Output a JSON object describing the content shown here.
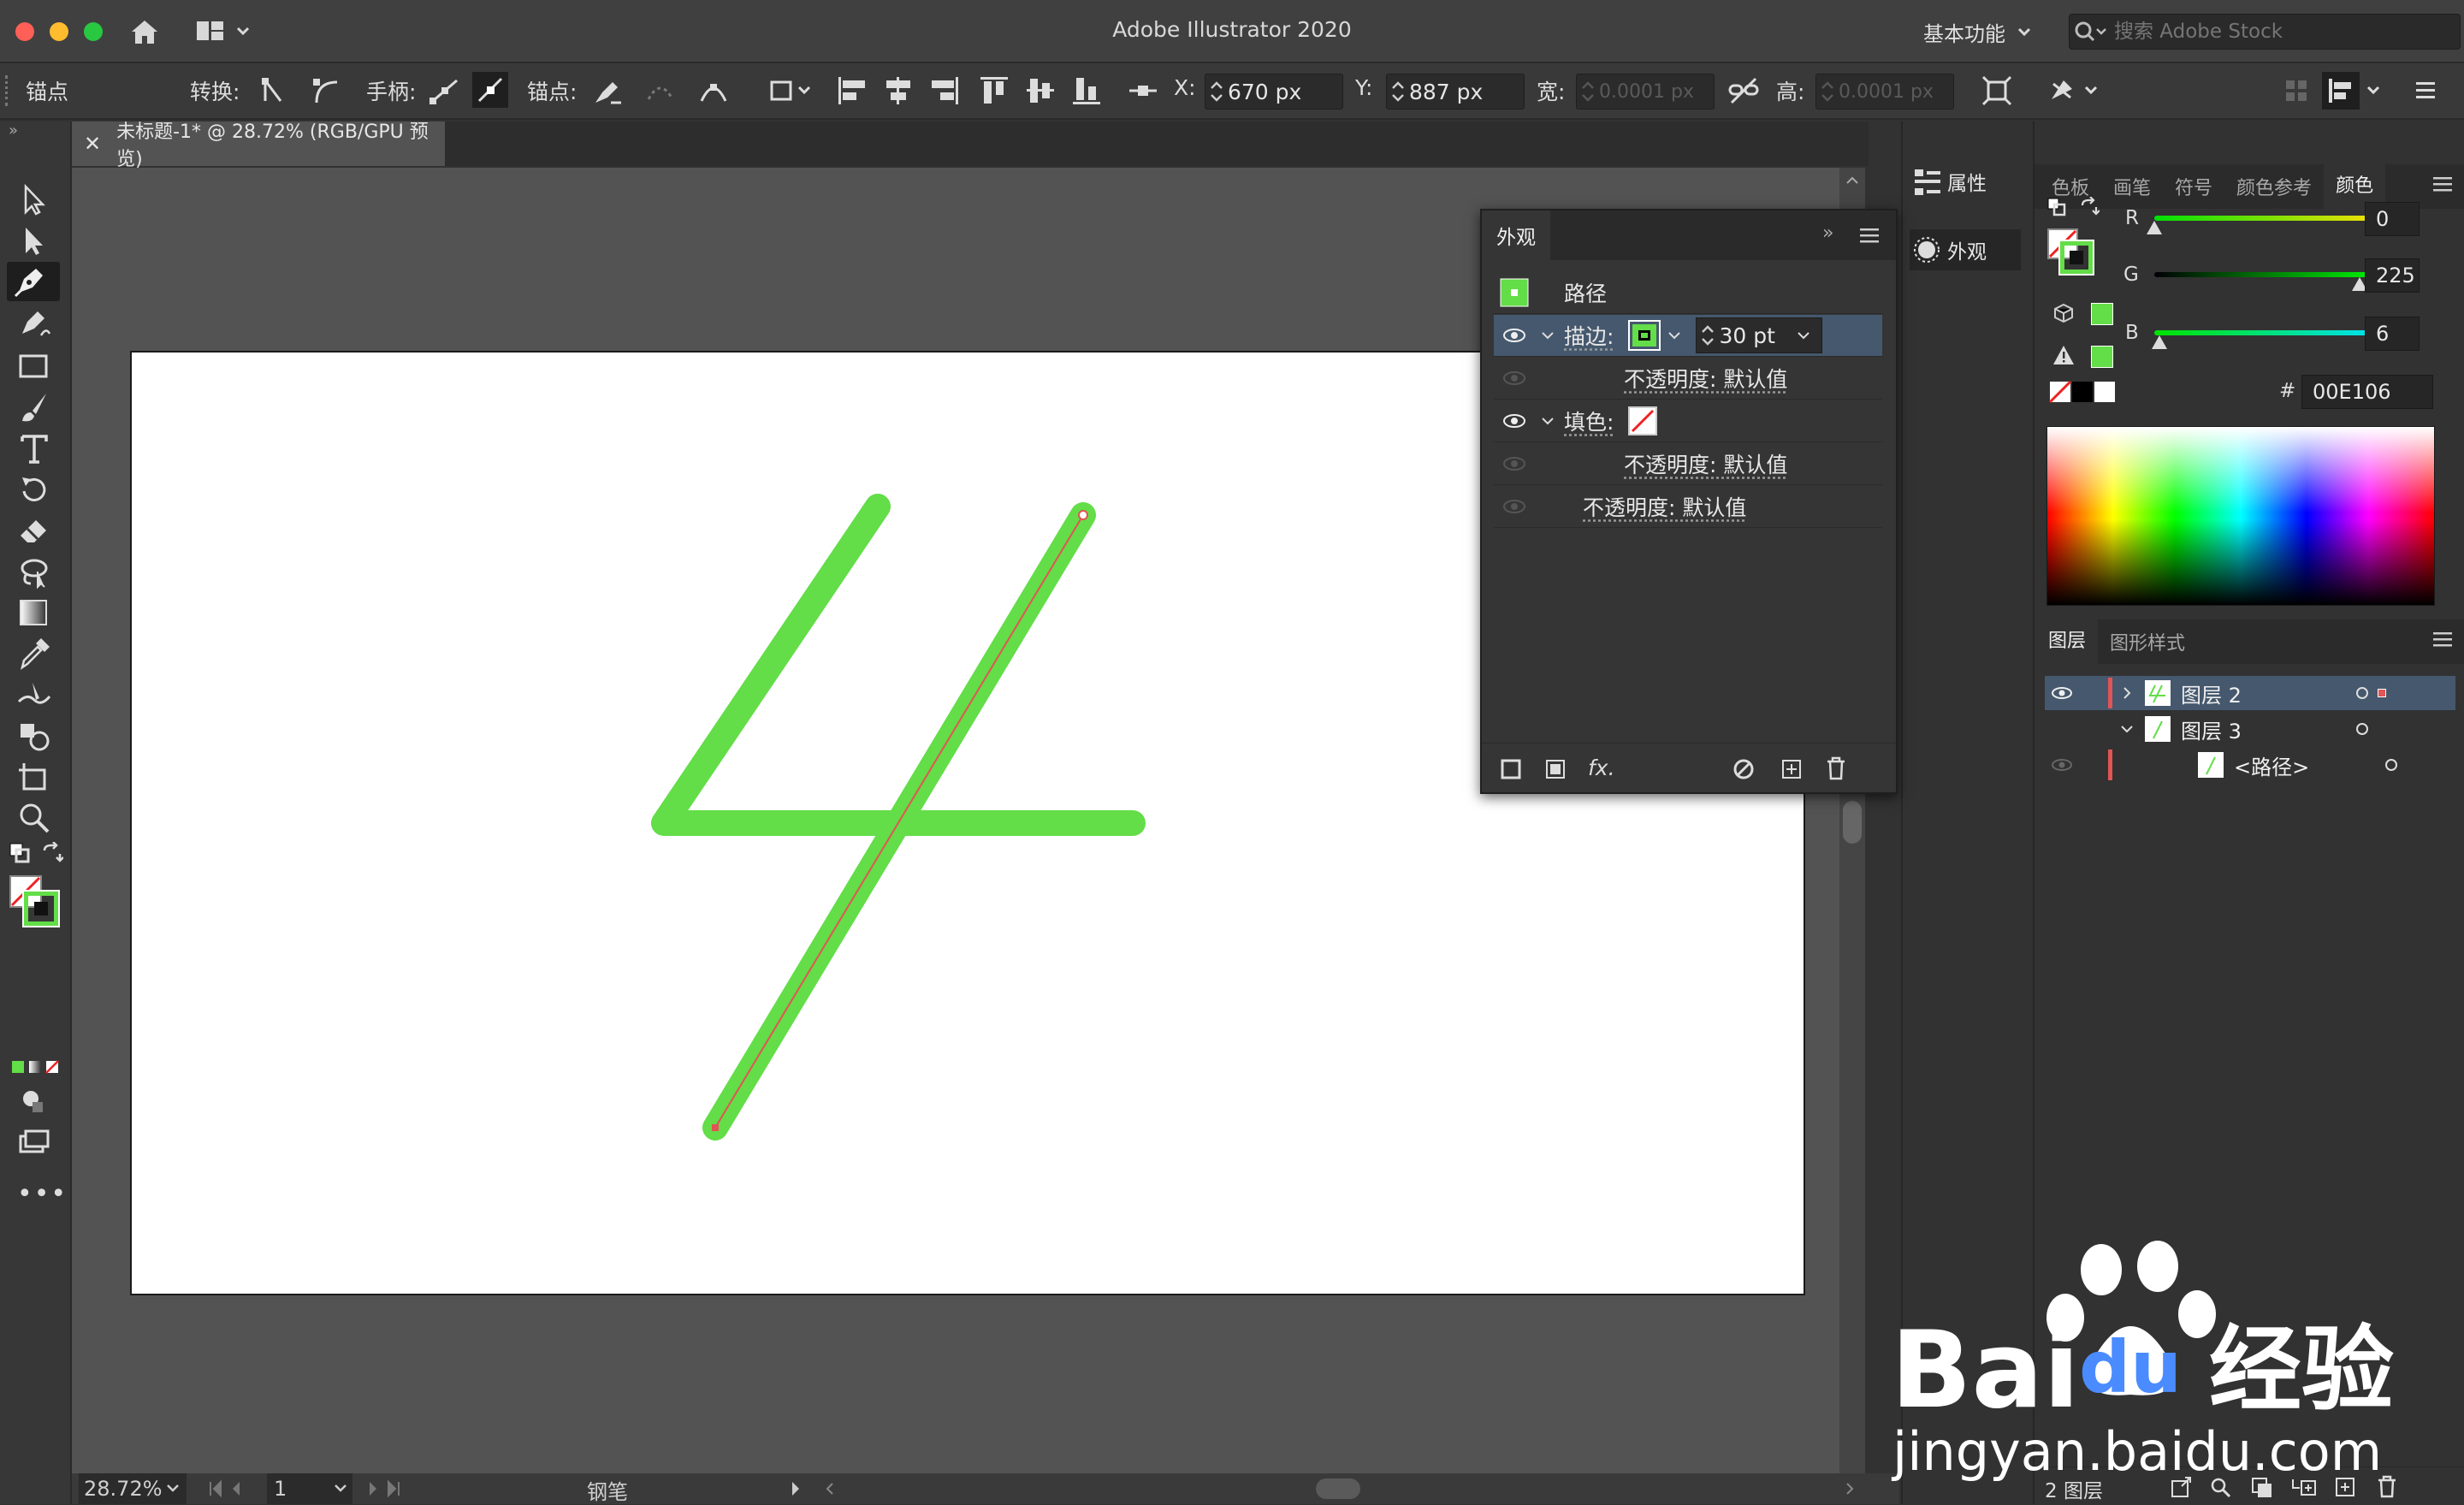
{
  "colors": {
    "stroke_green": "#63DD48",
    "accent_red": "#e25454",
    "layer_red": "#e05555"
  },
  "titlebar": {
    "app_title": "Adobe Illustrator 2020",
    "workspace": "基本功能",
    "search_placeholder": "搜索 Adobe Stock"
  },
  "controlbar": {
    "anchor_label": "锚点",
    "convert_label": "转换:",
    "handles_label": "手柄:",
    "anchors_label": "锚点:",
    "x_label": "X:",
    "x_value": "670 px",
    "y_label": "Y:",
    "y_value": "887 px",
    "w_label": "宽:",
    "w_value": "0.0001 px",
    "h_label": "高:",
    "h_value": "0.0001 px"
  },
  "document": {
    "tab_title": "未标题-1* @ 28.72% (RGB/GPU 预览)"
  },
  "statusbar": {
    "zoom": "28.72%",
    "artboard": "1",
    "tool": "钢笔"
  },
  "properties_panel": {
    "properties_tab": "属性",
    "appearance_tab": "外观"
  },
  "appearance_panel": {
    "title": "外观",
    "object": "路径",
    "stroke_label": "描边:",
    "stroke_weight": "30 pt",
    "opacity_default": "不透明度: 默认值",
    "fill_label": "填色:",
    "fx_label": "fx."
  },
  "color_panel": {
    "tabs": [
      "色板",
      "画笔",
      "符号",
      "颜色参考",
      "颜色"
    ],
    "r_label": "R",
    "r_value": "0",
    "r": 0,
    "g_label": "G",
    "g_value": "225",
    "g": 225,
    "b_label": "B",
    "b_value": "6",
    "b": 6,
    "hex_label": "#",
    "hex_value": "00E106"
  },
  "layers_panel": {
    "tabs": [
      "图层",
      "图形样式"
    ],
    "layers": [
      {
        "name": "图层 2"
      },
      {
        "name": "图层 3"
      },
      {
        "name": "<路径>"
      }
    ],
    "count": "2 图层"
  },
  "watermark": {
    "brand_left": "Bai",
    "brand_mid": "du",
    "brand_cn": "经验",
    "url": "jingyan.baidu.com"
  }
}
